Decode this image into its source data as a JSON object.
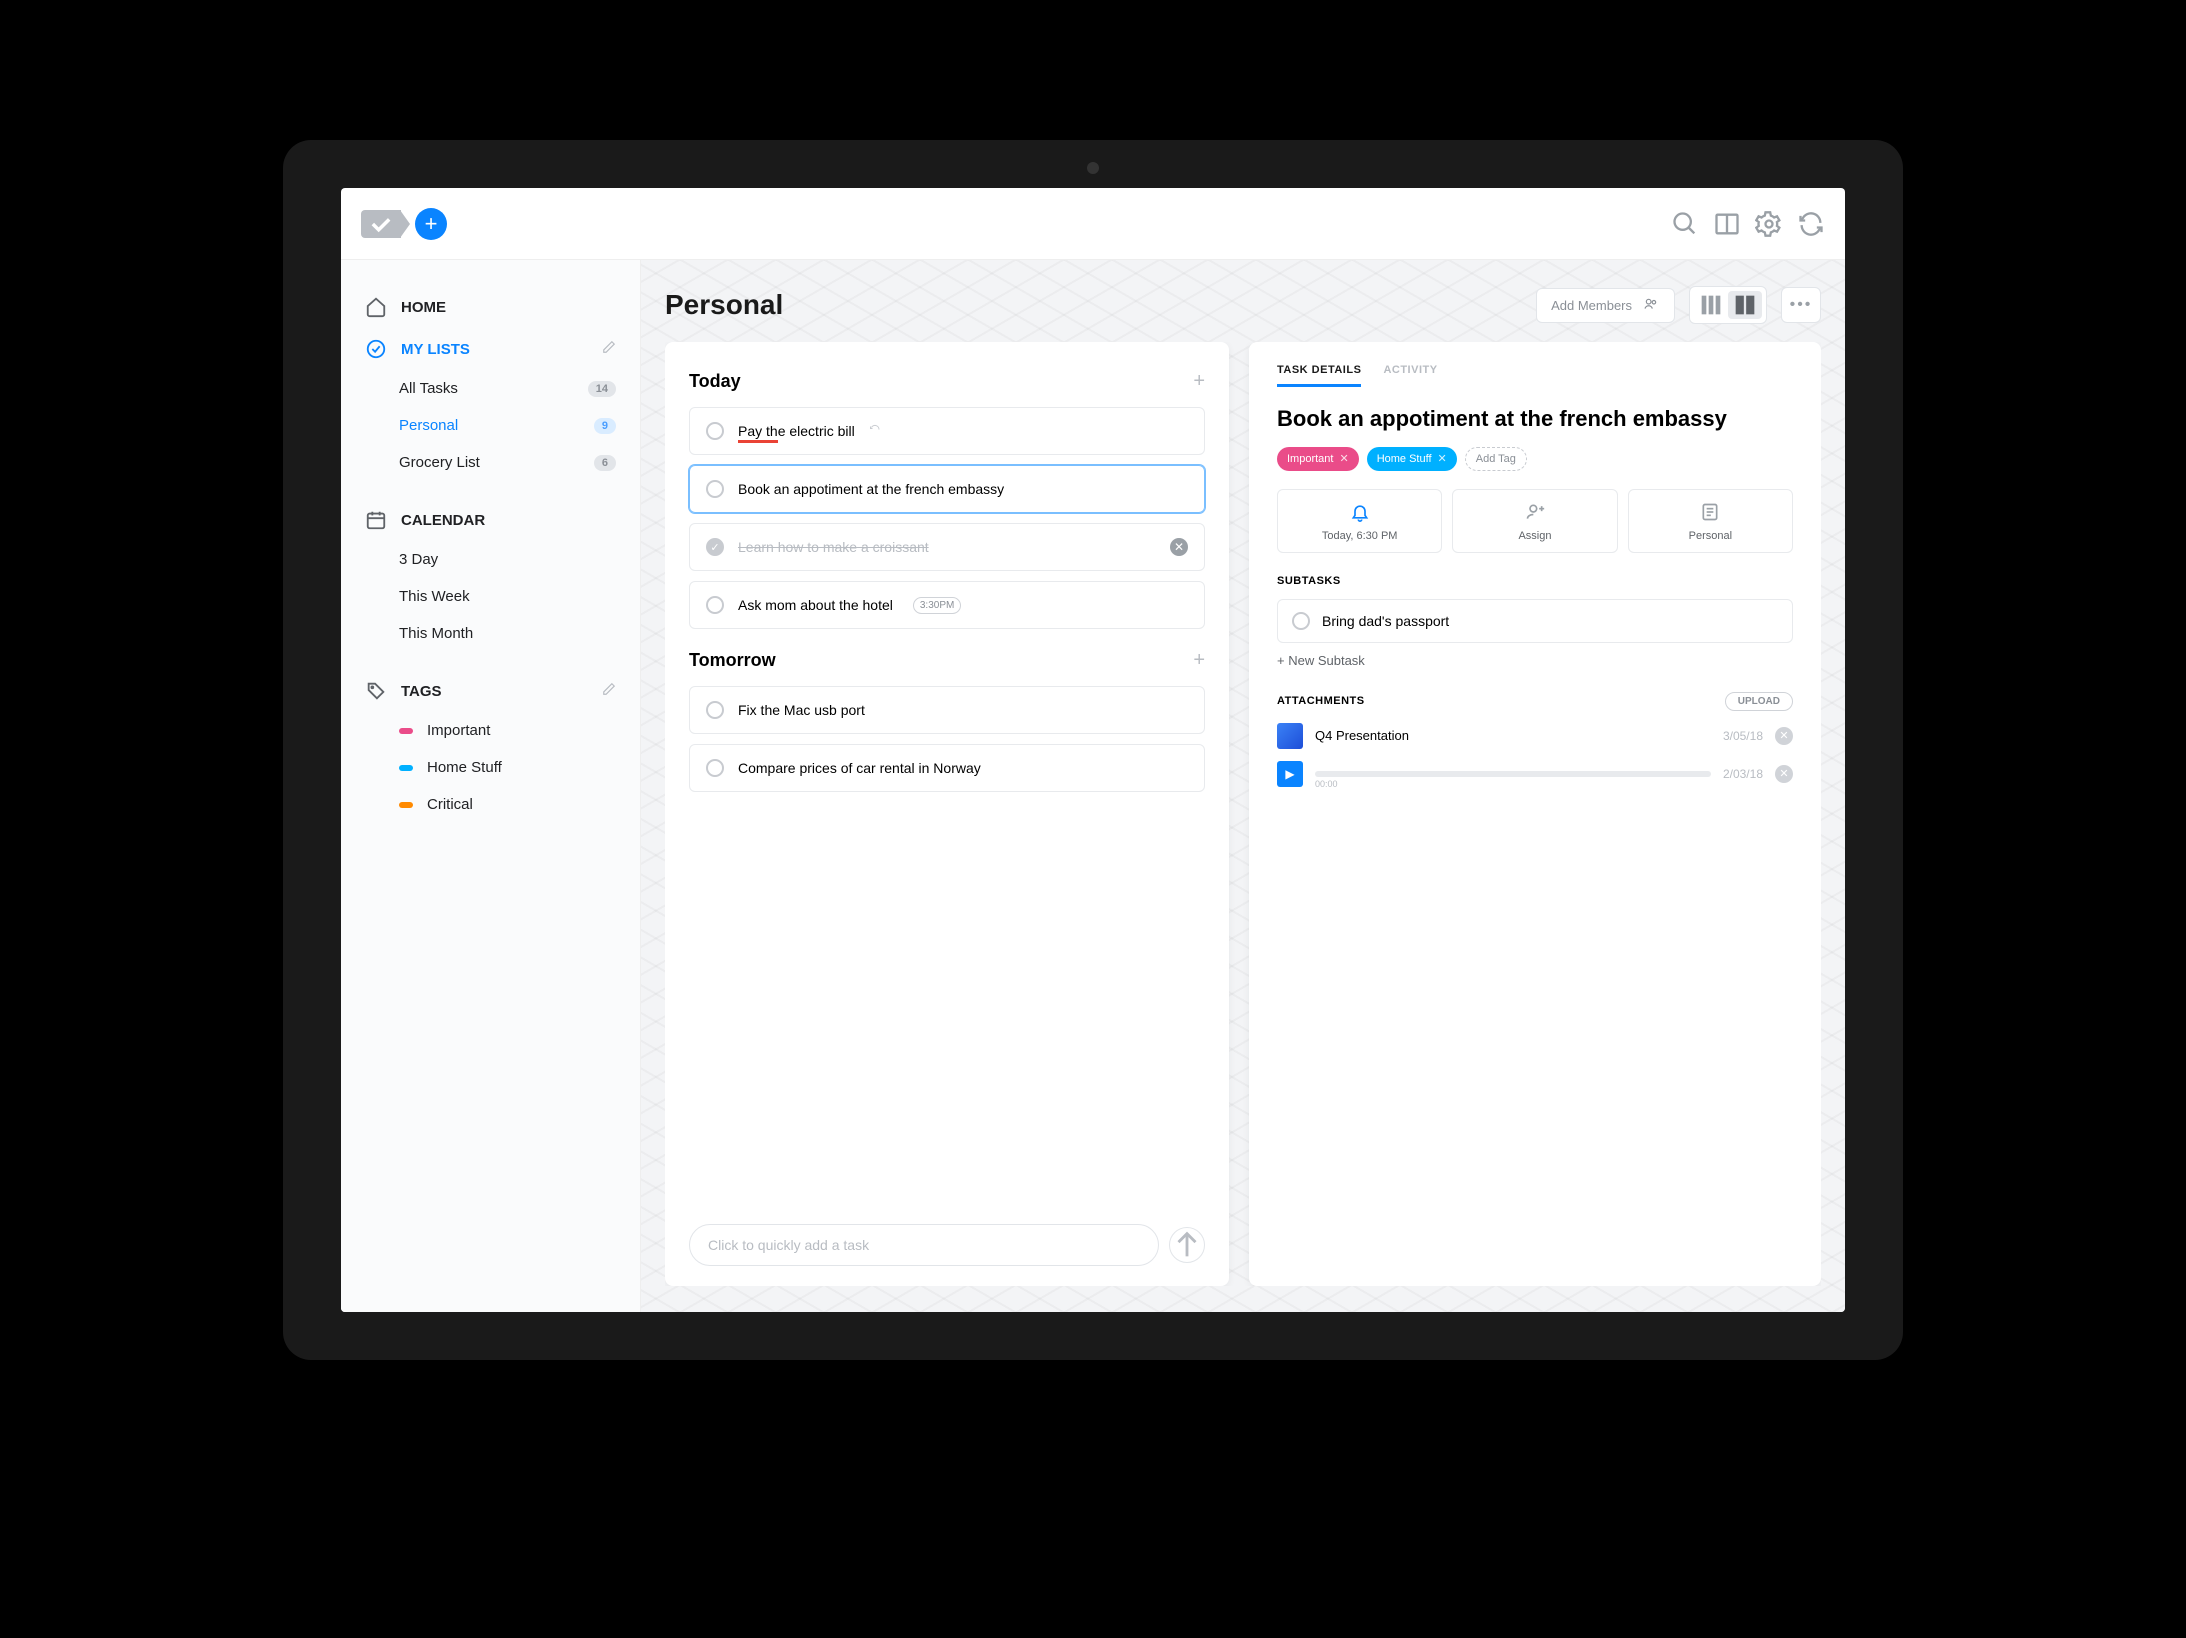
{
  "sidebar": {
    "home": "HOME",
    "my_lists": "MY LISTS",
    "lists": [
      {
        "label": "All Tasks",
        "count": "14"
      },
      {
        "label": "Personal",
        "count": "9"
      },
      {
        "label": "Grocery List",
        "count": "6"
      }
    ],
    "calendar": "CALENDAR",
    "cal_views": [
      {
        "label": "3 Day"
      },
      {
        "label": "This Week"
      },
      {
        "label": "This Month"
      }
    ],
    "tags_label": "TAGS",
    "tags": [
      {
        "label": "Important",
        "color": "#ea4c89"
      },
      {
        "label": "Home Stuff",
        "color": "#00b0ff"
      },
      {
        "label": "Critical",
        "color": "#ff8a00"
      }
    ]
  },
  "main": {
    "title": "Personal",
    "add_members": "Add Members",
    "groups": [
      {
        "name": "Today",
        "tasks": [
          {
            "label": "Pay the electric bill",
            "underline": true
          },
          {
            "label": "Book an appotiment at the french embassy",
            "selected": true
          },
          {
            "label": "Learn how to make a croissant",
            "done": true,
            "deletable": true
          },
          {
            "label": "Ask mom about the hotel",
            "badge": "3:30PM"
          }
        ]
      },
      {
        "name": "Tomorrow",
        "tasks": [
          {
            "label": "Fix the Mac usb port"
          },
          {
            "label": "Compare prices of car rental in Norway"
          }
        ]
      }
    ],
    "quick_add_placeholder": "Click to quickly add a task"
  },
  "details": {
    "tabs": {
      "task_details": "TASK DETAILS",
      "activity": "ACTIVITY"
    },
    "title": "Book an appotiment at the french embassy",
    "tags": [
      {
        "label": "Important",
        "color": "#ea4c89"
      },
      {
        "label": "Home Stuff",
        "color": "#00b0ff"
      }
    ],
    "add_tag": "Add Tag",
    "info": {
      "reminder": "Today, 6:30 PM",
      "assign": "Assign",
      "list": "Personal"
    },
    "subtasks_label": "SUBTASKS",
    "subtasks": [
      {
        "label": "Bring dad's passport"
      }
    ],
    "new_subtask": "+ New Subtask",
    "attachments_label": "ATTACHMENTS",
    "upload": "UPLOAD",
    "attachments": [
      {
        "type": "doc",
        "label": "Q4 Presentation",
        "date": "3/05/18"
      },
      {
        "type": "audio",
        "date": "2/03/18",
        "time": "00:00"
      }
    ]
  }
}
